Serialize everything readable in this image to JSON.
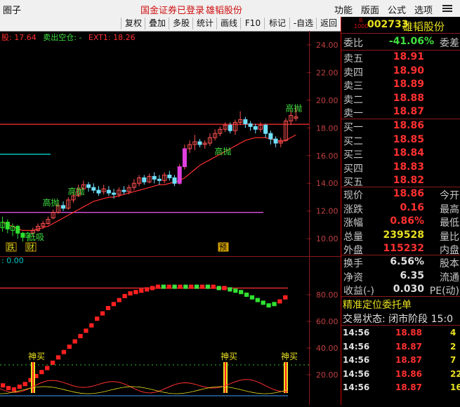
{
  "titlebar": {
    "app_title": "圈子",
    "login_status": "国金证券已登录",
    "stock_name": "雄韬股份",
    "menus": [
      "功能",
      "版面",
      "公式",
      "选项"
    ]
  },
  "toolbar": {
    "buttons": [
      "复权",
      "叠加",
      "多股",
      "统计",
      "画线",
      "F10",
      "标记",
      "-自选",
      "返回"
    ]
  },
  "chart_header": {
    "parts": [
      "股: 17.64",
      "卖出空仓: -",
      "EXT1: 18.26"
    ]
  },
  "indicator_header": ": 0.00",
  "chart_data": [
    {
      "type": "candlestick",
      "yticks": [
        "24.00",
        "22.00",
        "20.00",
        "18.00",
        "16.00",
        "14.00",
        "12.00",
        "10.00"
      ],
      "ylim": [
        9.2,
        24.6
      ],
      "candles": [
        [
          10.8,
          11.2,
          10.5,
          11.6
        ],
        [
          11.2,
          10.7,
          10.4,
          11.4
        ],
        [
          10.6,
          10.9,
          10.2,
          11.1
        ],
        [
          10.9,
          10.4,
          10.0,
          11.0
        ],
        [
          10.4,
          10.1,
          9.8,
          10.5
        ],
        [
          10.1,
          10.4,
          9.8,
          10.5
        ],
        [
          10.4,
          10.6,
          10.2,
          10.8
        ],
        [
          10.6,
          10.9,
          10.5,
          11.1
        ],
        [
          10.9,
          11.1,
          10.7,
          11.3
        ],
        [
          11.1,
          11.4,
          11.0,
          11.6
        ],
        [
          11.5,
          11.9,
          11.4,
          12.1
        ],
        [
          11.9,
          12.4,
          11.8,
          12.6
        ],
        [
          12.4,
          12.2,
          12.0,
          12.7
        ],
        [
          12.2,
          12.8,
          12.1,
          13.0
        ],
        [
          12.8,
          13.1,
          12.6,
          13.4
        ],
        [
          13.1,
          13.6,
          13.0,
          13.9
        ],
        [
          13.6,
          13.9,
          13.5,
          14.2
        ],
        [
          13.9,
          13.7,
          13.4,
          14.1
        ],
        [
          13.7,
          13.5,
          13.3,
          14.0
        ],
        [
          13.5,
          13.3,
          13.1,
          13.8
        ],
        [
          13.4,
          13.6,
          13.2,
          13.9
        ],
        [
          13.5,
          13.3,
          13.1,
          13.8
        ],
        [
          13.3,
          13.2,
          12.9,
          13.6
        ],
        [
          13.2,
          13.5,
          13.0,
          13.7
        ],
        [
          13.5,
          13.4,
          13.2,
          13.8
        ],
        [
          13.4,
          13.7,
          13.2,
          13.9
        ],
        [
          13.7,
          14.0,
          13.5,
          14.3
        ],
        [
          14.0,
          14.4,
          13.8,
          14.6
        ],
        [
          14.4,
          14.1,
          13.9,
          14.6
        ],
        [
          14.1,
          14.5,
          14.0,
          14.7
        ],
        [
          14.5,
          14.3,
          14.0,
          14.8
        ],
        [
          14.3,
          14.2,
          13.9,
          14.6
        ],
        [
          14.2,
          14.6,
          14.0,
          14.8
        ],
        [
          14.6,
          14.4,
          14.2,
          14.9
        ],
        [
          14.4,
          14.0,
          13.8,
          14.6
        ],
        [
          14.0,
          15.2,
          13.9,
          15.4
        ],
        [
          15.2,
          16.5,
          15.0,
          16.8
        ],
        [
          16.5,
          16.8,
          16.2,
          17.1
        ],
        [
          16.8,
          17.0,
          16.4,
          17.5
        ],
        [
          17.0,
          16.8,
          16.6,
          17.2
        ],
        [
          16.8,
          16.9,
          16.5,
          17.1
        ],
        [
          16.9,
          17.3,
          16.7,
          17.6
        ],
        [
          17.3,
          17.6,
          17.1,
          17.9
        ],
        [
          17.6,
          17.9,
          17.4,
          18.1
        ],
        [
          17.9,
          18.2,
          17.7,
          18.4
        ],
        [
          18.2,
          17.8,
          17.6,
          18.4
        ],
        [
          17.8,
          18.4,
          17.5,
          18.6
        ],
        [
          18.4,
          18.6,
          18.2,
          19.2
        ],
        [
          18.6,
          18.3,
          18.0,
          18.8
        ],
        [
          18.3,
          18.1,
          17.8,
          18.5
        ],
        [
          18.1,
          17.9,
          17.6,
          18.3
        ],
        [
          17.9,
          18.2,
          17.7,
          18.4
        ],
        [
          18.2,
          17.6,
          17.3,
          18.3
        ],
        [
          17.6,
          17.2,
          16.8,
          17.8
        ],
        [
          17.2,
          16.9,
          16.6,
          17.4
        ],
        [
          16.9,
          17.1,
          16.6,
          17.3
        ],
        [
          17.1,
          18.5,
          17.0,
          18.7
        ],
        [
          18.5,
          18.9,
          18.2,
          19.3
        ],
        [
          18.7,
          18.8,
          18.5,
          19.5
        ]
      ],
      "ma": [
        11.2,
        11.0,
        10.9,
        10.7,
        10.6,
        10.6,
        10.6,
        10.7,
        10.8,
        10.9,
        11.1,
        11.3,
        11.5,
        11.7,
        11.9,
        12.1,
        12.3,
        12.5,
        12.7,
        12.8,
        12.9,
        13.0,
        13.0,
        13.1,
        13.2,
        13.3,
        13.4,
        13.5,
        13.6,
        13.7,
        13.8,
        13.9,
        13.9,
        14.0,
        14.1,
        14.2,
        14.4,
        14.7,
        15.0,
        15.3,
        15.5,
        15.7,
        15.9,
        16.1,
        16.3,
        16.5,
        16.7,
        16.9,
        17.1,
        17.2,
        17.3,
        17.3,
        17.3,
        17.2,
        17.1,
        17.0,
        17.1,
        17.3,
        17.5
      ],
      "hlines": [
        {
          "value": 18.26,
          "color": "#ff3030"
        },
        {
          "value": 16.1,
          "color": "#00d0d0"
        },
        {
          "value": 11.9,
          "color": "#e050e0"
        }
      ],
      "annotations": [
        "高抛",
        "高抛",
        "高抛",
        "高抛",
        "低吸"
      ],
      "markers": [
        "跌",
        "财",
        "预"
      ]
    },
    {
      "type": "bar",
      "yticks": [
        "80.00",
        "60.00",
        "40.00",
        "20.00"
      ],
      "ylim": [
        0,
        100
      ],
      "ref_line": 85,
      "values": [
        12,
        10,
        9,
        11,
        13,
        16,
        19,
        22,
        25,
        29,
        33,
        37,
        41,
        45,
        49,
        53,
        57,
        62,
        66,
        70,
        73,
        76,
        79,
        81,
        82,
        83,
        84,
        85,
        86,
        86,
        86,
        86,
        86,
        86,
        86,
        86,
        86,
        86,
        86,
        85,
        85,
        84,
        83,
        82,
        80,
        78,
        76,
        74,
        72,
        73,
        75,
        78
      ],
      "signals": [
        "神买",
        "神买",
        "神买"
      ]
    }
  ],
  "quote": {
    "code": "002733",
    "name": "雄韬股份",
    "badge_top": "R",
    "badge_bottom": "1000",
    "weibi_label": "委比",
    "weibi_value": "-41.06%",
    "weicha_label": "委差",
    "asks": [
      {
        "label": "卖五",
        "price": "18.91"
      },
      {
        "label": "卖四",
        "price": "18.90"
      },
      {
        "label": "卖三",
        "price": "18.89"
      },
      {
        "label": "卖二",
        "price": "18.88"
      },
      {
        "label": "卖一",
        "price": "18.87"
      }
    ],
    "bids": [
      {
        "label": "买一",
        "price": "18.86"
      },
      {
        "label": "买二",
        "price": "18.85"
      },
      {
        "label": "买三",
        "price": "18.84"
      },
      {
        "label": "买四",
        "price": "18.83"
      },
      {
        "label": "买五",
        "price": "18.82"
      }
    ],
    "stats1": [
      {
        "label": "现价",
        "value": "18.86",
        "label2": "今开",
        "color": "#ff3030"
      },
      {
        "label": "涨跌",
        "value": "0.16",
        "label2": "最高",
        "color": "#ff3030"
      },
      {
        "label": "涨幅",
        "value": "0.86%",
        "label2": "最低",
        "color": "#ff3030"
      },
      {
        "label": "总量",
        "value": "239528",
        "label2": "量比",
        "color": "#e8e020"
      },
      {
        "label": "外盘",
        "value": "115232",
        "label2": "内盘",
        "color": "#ff3030"
      }
    ],
    "stats2": [
      {
        "label": "换手",
        "value": "6.56%",
        "label2": "股本",
        "color": "#e0e0e0"
      },
      {
        "label": "净资",
        "value": "6.35",
        "label2": "流通",
        "color": "#e0e0e0"
      },
      {
        "label": "收益(-)",
        "value": "0.030",
        "label2": "PE(动)",
        "color": "#e0e0e0"
      }
    ],
    "precise_label": "精准定位委托单",
    "trade_status": "交易状态: 闭市阶段 15:0",
    "ticks": [
      {
        "time": "14:56",
        "price": "18.88",
        "vol": "4",
        "color": "#ff3030"
      },
      {
        "time": "14:56",
        "price": "18.87",
        "vol": "2",
        "color": "#ff3030"
      },
      {
        "time": "14:56",
        "price": "18.87",
        "vol": "7",
        "color": "#ff3030"
      },
      {
        "time": "14:56",
        "price": "18.86",
        "vol": "22",
        "color": "#ff3030"
      },
      {
        "time": "14:56",
        "price": "18.87",
        "vol": "16",
        "color": "#ff3030"
      }
    ]
  }
}
